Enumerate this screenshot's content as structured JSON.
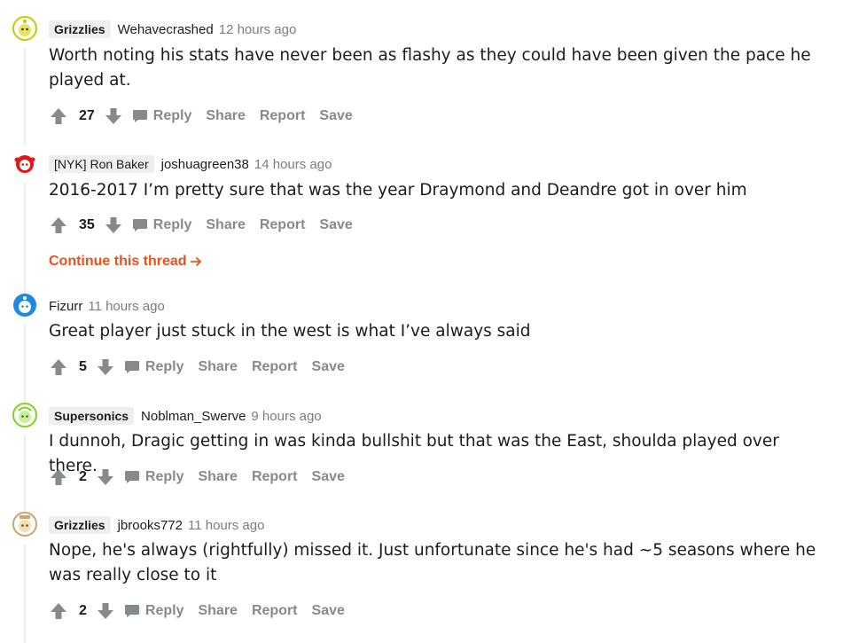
{
  "comments": [
    {
      "flair": "Grizzlies",
      "author": "Wehavecrashed",
      "time": "12 hours ago",
      "body": "Worth noting his stats have never been as flashy as they could have been given the pace he played at.",
      "score": "27",
      "avatar_color": "#c7c900"
    },
    {
      "flair": "[NYK] Ron Baker",
      "author": "joshuagreen38",
      "time": "14 hours ago",
      "body": "2016-2017 I’m pretty sure that was the year Draymond and Deandre got in over him",
      "score": "35",
      "avatar_color": "#e2161b"
    },
    {
      "flair": "",
      "author": "Fizurr",
      "time": "11 hours ago",
      "body": "Great player just stuck in the west is what I’ve always said",
      "score": "5",
      "avatar_color": "#1e88e5"
    },
    {
      "flair": "Supersonics",
      "author": "Noblman_Swerve",
      "time": "9 hours ago",
      "body": "I dunnoh, Dragic getting in was kinda bullshit but that was the East, shoulda played over there.",
      "score": "2",
      "avatar_color": "#7ed321"
    },
    {
      "flair": "Grizzlies",
      "author": "jbrooks772",
      "time": "11 hours ago",
      "body": "Nope, he's always (rightfully) missed it. Just unfortunate since he's had ~5 seasons where he was really close to it",
      "score": "2",
      "avatar_color": "#c9a66b"
    }
  ],
  "actions": {
    "reply": "Reply",
    "share": "Share",
    "report": "Report",
    "save": "Save"
  },
  "continue_thread": "Continue this thread",
  "icons": {
    "upvote": "upvote-arrow-icon",
    "downvote": "downvote-arrow-icon",
    "reply": "comment-bubble-icon",
    "continue": "arrow-right-icon"
  },
  "colors": {
    "accent": "#e8521a",
    "muted": "#878a8c",
    "text": "#1c1c1c"
  }
}
